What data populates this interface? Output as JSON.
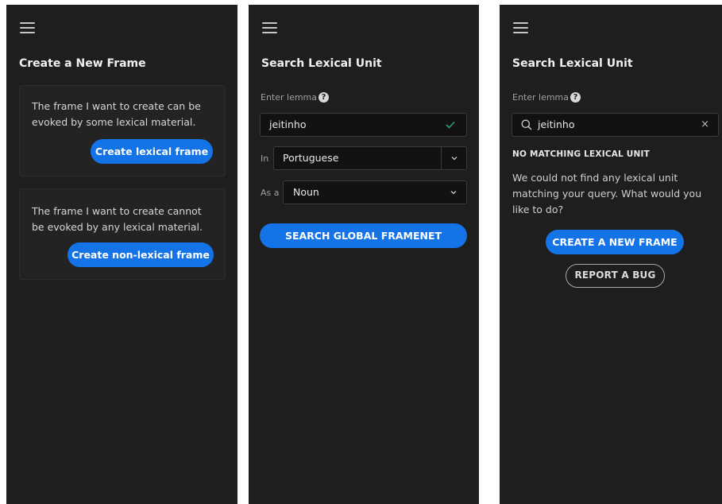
{
  "colors": {
    "panel_bg": "#1e1e1f",
    "accent": "#1473e6",
    "valid_check": "#2d9d78"
  },
  "panel1": {
    "title": "Create a New Frame",
    "card_lexical": {
      "text": "The frame I want to create can be evoked by some lexical material.",
      "button": "Create lexical frame"
    },
    "card_nonlexical": {
      "text": "The frame I want to create cannot be evoked by any lexical material.",
      "button": "Create non-lexical frame"
    }
  },
  "panel2": {
    "title": "Search Lexical Unit",
    "lemma_label": "Enter lemma",
    "lemma_value": "jeitinho",
    "in_label": "In",
    "language_value": "Portuguese",
    "as_label": "As a",
    "pos_value": "Noun",
    "search_button": "SEARCH GLOBAL FRAMENET"
  },
  "panel3": {
    "title": "Search Lexical Unit",
    "lemma_label": "Enter lemma",
    "search_value": "jeitinho",
    "clear_glyph": "×",
    "no_match_title": "NO MATCHING LEXICAL UNIT",
    "no_match_desc": "We could not find any lexical unit matching your query. What would you like to do?",
    "create_button": "CREATE A NEW FRAME",
    "report_button": "REPORT A BUG"
  }
}
